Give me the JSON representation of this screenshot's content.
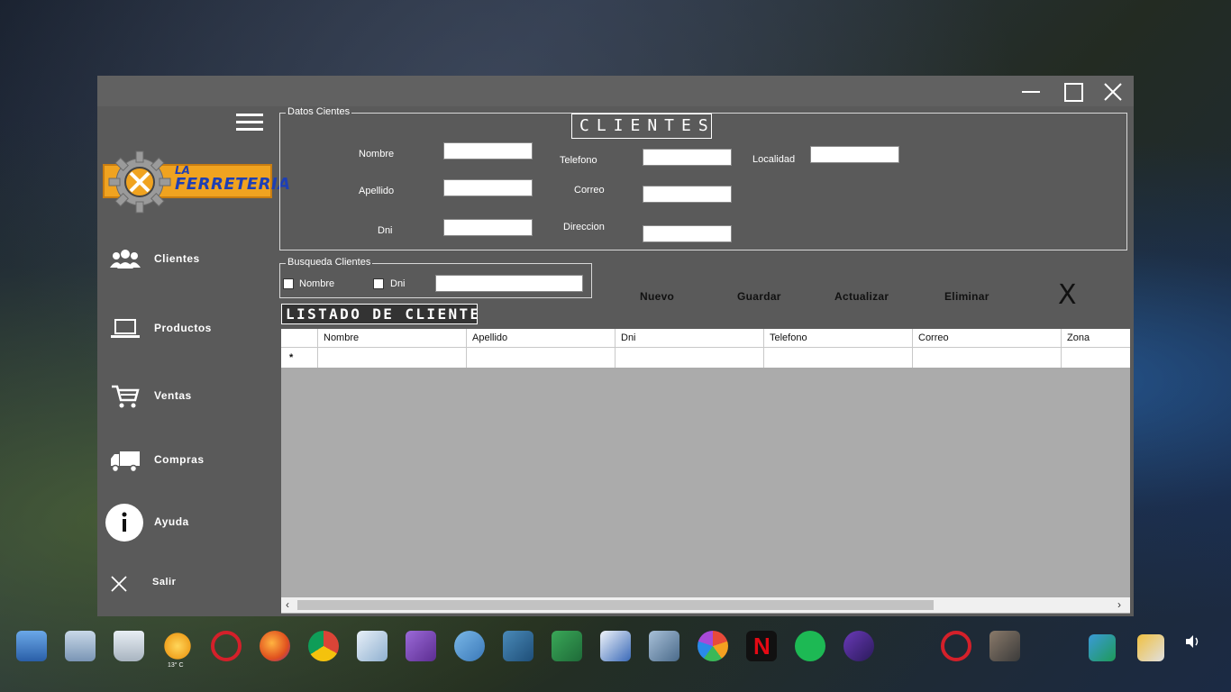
{
  "window": {
    "controls": {
      "minimize": "minimize",
      "maximize": "maximize",
      "close": "close"
    }
  },
  "logo": {
    "line1": "LA",
    "line2": "FERRETERIA"
  },
  "sidebar": {
    "items": [
      {
        "label": "Clientes",
        "icon": "users-icon"
      },
      {
        "label": "Productos",
        "icon": "laptop-icon"
      },
      {
        "label": "Ventas",
        "icon": "cart-icon"
      },
      {
        "label": "Compras",
        "icon": "truck-icon"
      },
      {
        "label": "Ayuda",
        "icon": "info-icon"
      },
      {
        "label": "Salir",
        "icon": "close-icon"
      }
    ]
  },
  "datos": {
    "group_title": "Datos Cientes",
    "title": "CLIENTES",
    "labels": {
      "nombre": "Nombre",
      "apellido": "Apellido",
      "dni": "Dni",
      "telefono": "Telefono",
      "correo": "Correo",
      "direccion": "Direccion",
      "localidad": "Localidad"
    },
    "values": {
      "nombre": "",
      "apellido": "",
      "dni": "",
      "telefono": "",
      "correo": "",
      "direccion": "",
      "localidad": ""
    }
  },
  "busqueda": {
    "group_title": "Busqueda Clientes",
    "opt_nombre": "Nombre",
    "opt_dni": "Dni",
    "value": ""
  },
  "actions": {
    "nuevo": "Nuevo",
    "guardar": "Guardar",
    "actualizar": "Actualizar",
    "eliminar": "Eliminar",
    "close": "X"
  },
  "listado": {
    "title": "LISTADO DE CLIENTES"
  },
  "grid": {
    "columns": [
      "Nombre",
      "Apellido",
      "Dni",
      "Telefono",
      "Correo",
      "Zona"
    ],
    "new_row_marker": "*"
  },
  "taskbar": {
    "weather": "13° C",
    "apps": [
      "finder-icon",
      "folder-icon",
      "trash-icon",
      "weather-icon",
      "opera-icon",
      "firefox-icon",
      "chrome-icon",
      "cube-icon",
      "visual-studio-icon",
      "dolphin-icon",
      "mysql-icon",
      "network-icon",
      "visio-icon",
      "virtualbox-icon",
      "camera-aperture-icon",
      "netflix-icon",
      "spotify-icon",
      "coffee-icon",
      "opera-icon",
      "film-icon"
    ]
  }
}
